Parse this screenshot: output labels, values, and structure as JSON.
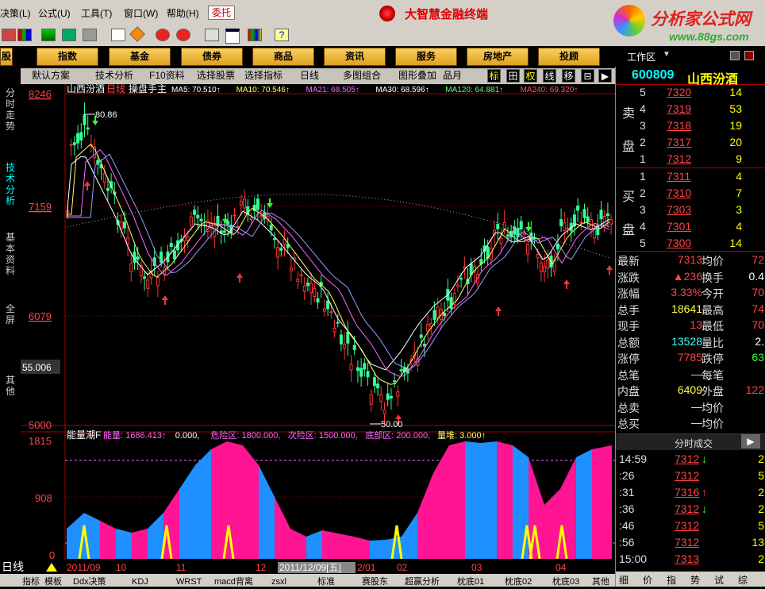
{
  "menu": {
    "items": [
      "决策(L)",
      "公式(U)",
      "工具(T)",
      "窗口(W)",
      "帮助(H)"
    ],
    "wt_label": "委托",
    "banner_title": "大智慧金融终端"
  },
  "brand": {
    "title": "分析家公式网",
    "url": "www.88gs.com"
  },
  "categories": [
    "股",
    "指数",
    "基金",
    "债券",
    "商品",
    "资讯",
    "服务",
    "房地产",
    "投顾"
  ],
  "workspace": "工作区",
  "tabs": {
    "items": [
      "默认方案",
      "技术分析",
      "F10资料",
      "选择股票",
      "选择指标",
      "日线",
      "多图组合",
      "图形叠加",
      "品月"
    ],
    "squares": [
      "标",
      "田",
      "权",
      "线",
      "移",
      "⊟",
      "▶"
    ]
  },
  "side_tabs": [
    "分时走势",
    "技术分析",
    "基本资料",
    "全屏",
    "其他"
  ],
  "chart": {
    "stock_name": "山西汾酒",
    "period": "日线",
    "tool": "操盘手主",
    "ma_legend": [
      {
        "text": "MA5: 70.510↑",
        "color": "#ffffff"
      },
      {
        "text": "MA10: 70.546↑",
        "color": "#ffff66"
      },
      {
        "text": "MA21: 68.505↑",
        "color": "#ff66ff"
      },
      {
        "text": "MA30: 68.596↑",
        "color": "#ffffff"
      },
      {
        "text": "MA120: 64.881↑",
        "color": "#66ff66"
      },
      {
        "text": "MA240: 69.320↑",
        "color": "#ff5555"
      }
    ],
    "y_labels": [
      "8246",
      "7159",
      "6079",
      "5000"
    ],
    "side_value": "55.006",
    "max_label": "80.86",
    "min_label": "50.00",
    "sub": {
      "title": "能量潮F",
      "legend": [
        {
          "text": "能量: 1686.413↑",
          "color": "#ff66ff"
        },
        {
          "text": "0.000,",
          "color": "#ffffff"
        },
        {
          "text": "危险区: 1800.000,",
          "color": "#ff66ff"
        },
        {
          "text": "次险区: 1500.000,",
          "color": "#ff66ff"
        },
        {
          "text": "底部区: 200.000,",
          "color": "#ff66ff"
        },
        {
          "text": "量堆: 3.000↑",
          "color": "#ffff66"
        }
      ],
      "y_labels": [
        "1815",
        "908",
        "0"
      ]
    },
    "x_labels": [
      "2011/09",
      "10",
      "11",
      "12",
      "2011/12/09[五]",
      "2/01",
      "02",
      "03",
      "04"
    ],
    "bottom_tabs": [
      "指标",
      "模板",
      "Ddx决策",
      "KDJ",
      "WRST",
      "macd背离",
      "zsxl",
      "标准",
      "赛股东",
      "超赢分析",
      "枕底01",
      "枕底02",
      "枕底03",
      "其他"
    ],
    "period_tab": "日线"
  },
  "quote": {
    "code": "600809",
    "name": "山西汾酒",
    "sell_label_1": "卖",
    "sell_label_2": "盘",
    "buy_label_1": "买",
    "buy_label_2": "盘",
    "sell": [
      {
        "level": "5",
        "price": "7320",
        "vol": "14"
      },
      {
        "level": "4",
        "price": "7319",
        "vol": "53"
      },
      {
        "level": "3",
        "price": "7318",
        "vol": "19"
      },
      {
        "level": "2",
        "price": "7317",
        "vol": "20"
      },
      {
        "level": "1",
        "price": "7312",
        "vol": "9"
      }
    ],
    "buy": [
      {
        "level": "1",
        "price": "7311",
        "vol": "4"
      },
      {
        "level": "2",
        "price": "7310",
        "vol": "7"
      },
      {
        "level": "3",
        "price": "7303",
        "vol": "3"
      },
      {
        "level": "4",
        "price": "7301",
        "vol": "4"
      },
      {
        "level": "5",
        "price": "7300",
        "vol": "14"
      }
    ],
    "stats": [
      {
        "l": "最新",
        "v": "7313",
        "vc": "#ff4444",
        "l2": "均价",
        "v2": "72",
        "v2c": "#ff4444"
      },
      {
        "l": "涨跌",
        "v": "▲236",
        "vc": "#ff4444",
        "l2": "换手",
        "v2": "0.4",
        "v2c": "#ffffff"
      },
      {
        "l": "涨幅",
        "v": "3.33%",
        "vc": "#ff4444",
        "l2": "今开",
        "v2": "70",
        "v2c": "#ff4444"
      },
      {
        "l": "总手",
        "v": "18641",
        "vc": "#ffff44",
        "l2": "最高",
        "v2": "74",
        "v2c": "#ff4444"
      },
      {
        "l": "现手",
        "v": "13",
        "vc": "#ff4444",
        "l2": "最低",
        "v2": "70",
        "v2c": "#ff4444"
      },
      {
        "l": "总额",
        "v": "13528",
        "vc": "#44ffff",
        "l2": "量比",
        "v2": "2.",
        "v2c": "#ffffff"
      },
      {
        "l": "涨停",
        "v": "7785",
        "vc": "#ff4444",
        "l2": "跌停",
        "v2": "63",
        "v2c": "#44ff44"
      },
      {
        "l": "总笔",
        "v": "—",
        "vc": "#dddddd",
        "l2": "每笔",
        "v2": "",
        "v2c": "#ffffff"
      },
      {
        "l": "内盘",
        "v": "6409",
        "vc": "#ffff44",
        "l2": "外盘",
        "v2": "122",
        "v2c": "#ff4444"
      },
      {
        "l": "总卖",
        "v": "—",
        "vc": "#dddddd",
        "l2": "均价",
        "v2": "",
        "v2c": "#ffffff"
      },
      {
        "l": "总买",
        "v": "—",
        "vc": "#dddddd",
        "l2": "均价",
        "v2": "",
        "v2c": "#ffffff"
      }
    ],
    "trades_header": "分时成交",
    "trades": [
      {
        "time": "14:59",
        "price": "7312",
        "arrow": "↓",
        "ac": "#44ff44",
        "vol": "2"
      },
      {
        "time": ":26",
        "price": "7312",
        "arrow": "",
        "ac": "#ffffff",
        "vol": "5"
      },
      {
        "time": ":31",
        "price": "7316",
        "arrow": "↑",
        "ac": "#ff4444",
        "vol": "2"
      },
      {
        "time": ":36",
        "price": "7312",
        "arrow": "↓",
        "ac": "#44ff44",
        "vol": "2"
      },
      {
        "time": ":46",
        "price": "7312",
        "arrow": "",
        "ac": "#ffffff",
        "vol": "5"
      },
      {
        "time": ":56",
        "price": "7312",
        "arrow": "",
        "ac": "#ffffff",
        "vol": "13"
      },
      {
        "time": "15:00",
        "price": "7313",
        "arrow": "",
        "ac": "#ffffff",
        "vol": "2"
      }
    ],
    "bottom_tabs": [
      "细",
      "价",
      "指",
      "势",
      "试",
      "综"
    ]
  }
}
